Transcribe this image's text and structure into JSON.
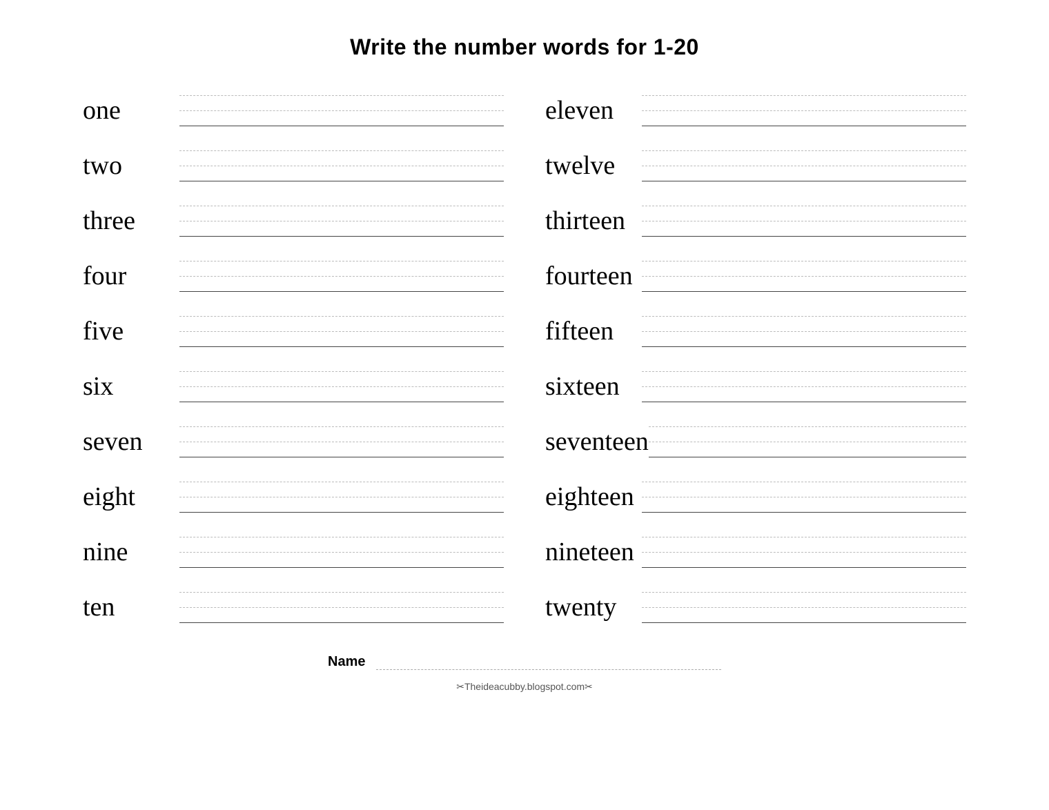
{
  "title": "Write the number words for  1-20",
  "left_column": [
    {
      "word": "one"
    },
    {
      "word": "two"
    },
    {
      "word": "three"
    },
    {
      "word": "four"
    },
    {
      "word": "five"
    },
    {
      "word": "six"
    },
    {
      "word": "seven"
    },
    {
      "word": "eight"
    },
    {
      "word": "nine"
    },
    {
      "word": "ten"
    }
  ],
  "right_column": [
    {
      "word": "eleven"
    },
    {
      "word": "twelve"
    },
    {
      "word": "thirteen"
    },
    {
      "word": "fourteen"
    },
    {
      "word": "fifteen"
    },
    {
      "word": "sixteen"
    },
    {
      "word": "seventeen"
    },
    {
      "word": "eighteen"
    },
    {
      "word": "nineteen"
    },
    {
      "word": "twenty"
    }
  ],
  "footer": {
    "name_label": "Name",
    "attribution": "✂Theideacubby.blogspot.com✂"
  }
}
